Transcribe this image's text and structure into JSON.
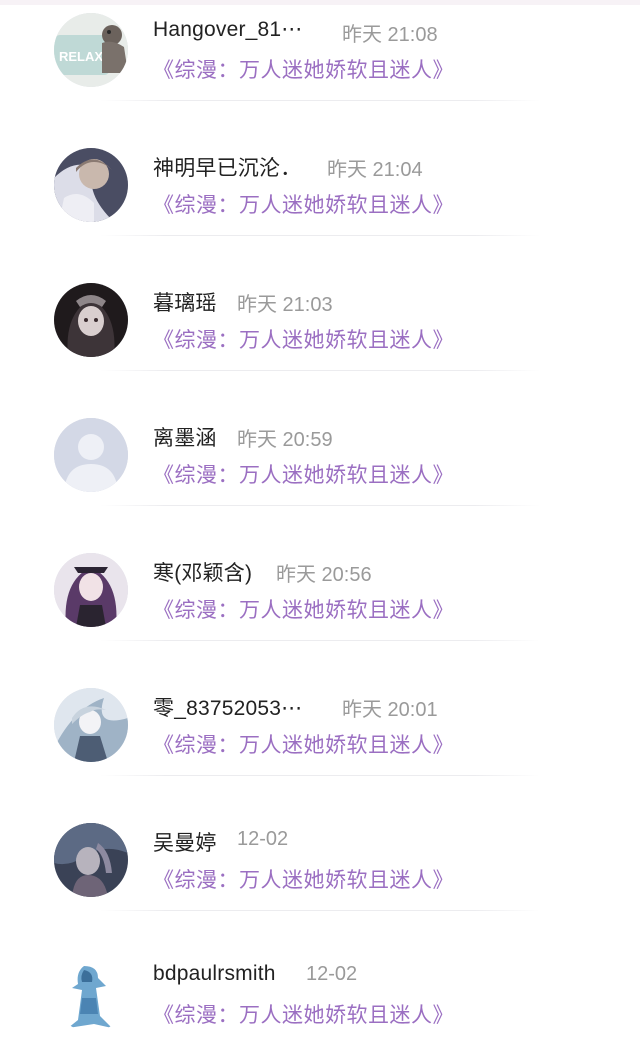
{
  "comments": [
    {
      "name": "Hangover_81⋯",
      "time": "昨天 21:08",
      "book": "《综漫：万人迷她娇软且迷人》",
      "avatar_text": "RELAX"
    },
    {
      "name": "神明早已沉沦．",
      "time": "昨天 21:04",
      "book": "《综漫：万人迷她娇软且迷人》"
    },
    {
      "name": "暮璃瑶",
      "time": "昨天 21:03",
      "book": "《综漫：万人迷她娇软且迷人》"
    },
    {
      "name": "离墨涵",
      "time": "昨天 20:59",
      "book": "《综漫：万人迷她娇软且迷人》"
    },
    {
      "name": "寒(邓颖含)",
      "time": "昨天 20:56",
      "book": "《综漫：万人迷她娇软且迷人》"
    },
    {
      "name": "零_83752053⋯",
      "time": "昨天 20:01",
      "book": "《综漫：万人迷她娇软且迷人》"
    },
    {
      "name": "吴曼婷",
      "time": "12-02",
      "book": "《综漫：万人迷她娇软且迷人》"
    },
    {
      "name": "bdpaulrsmith",
      "time": "12-02",
      "book": "《综漫：万人迷她娇软且迷人》"
    }
  ],
  "colors": {
    "book_link": "#9b6fc2",
    "time": "#9a9a9a",
    "name": "#222222"
  }
}
